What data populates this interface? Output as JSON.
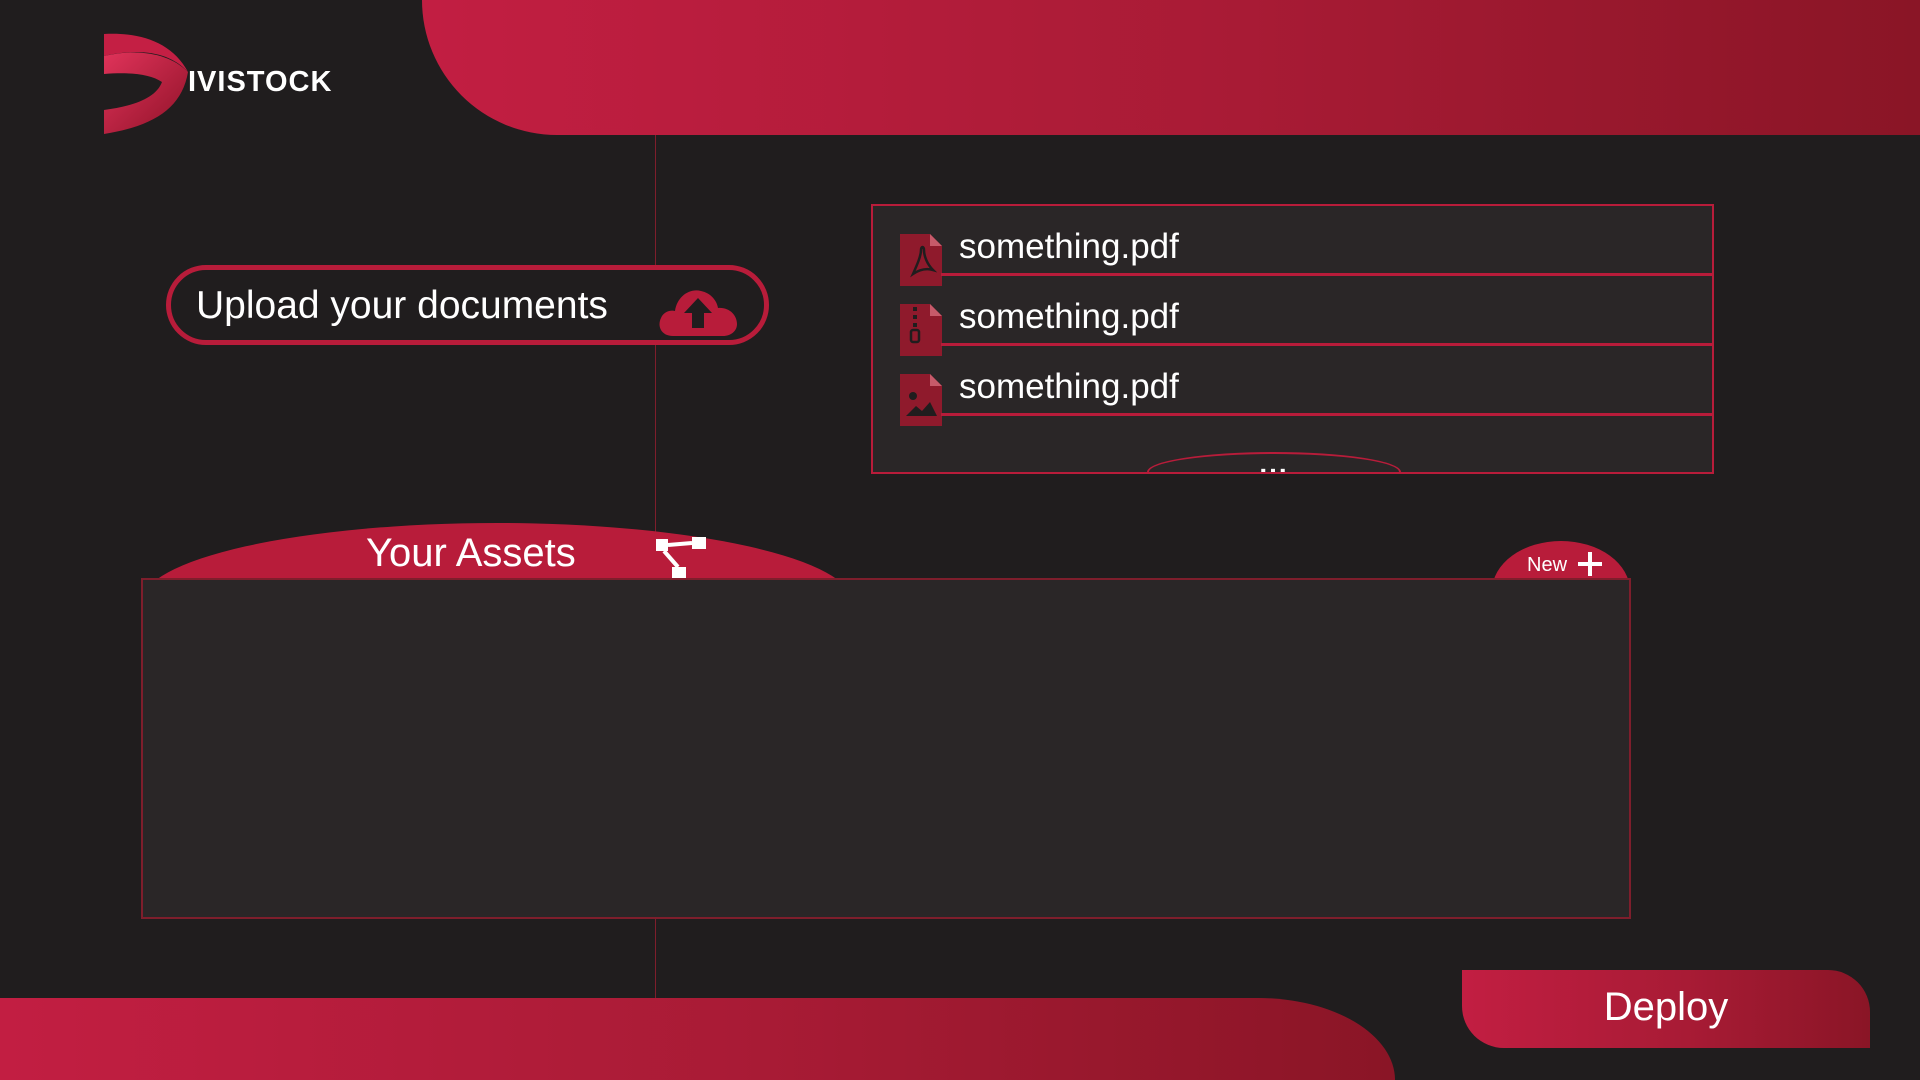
{
  "brand": {
    "name": "IVISTOCK",
    "accent": "#b81c3a",
    "background": "#201d1e",
    "panel": "#2a2627"
  },
  "upload": {
    "label": "Upload your documents",
    "icon": "cloud-upload-icon"
  },
  "files": {
    "items": [
      {
        "name": "something.pdf",
        "icon": "pdf-file-icon"
      },
      {
        "name": "something.pdf",
        "icon": "zip-file-icon"
      },
      {
        "name": "something.pdf",
        "icon": "image-file-icon"
      }
    ],
    "more": "..."
  },
  "assets": {
    "title": "Your Assets",
    "icon": "network-icon",
    "new_label": "New"
  },
  "deploy": {
    "label": "Deploy"
  }
}
